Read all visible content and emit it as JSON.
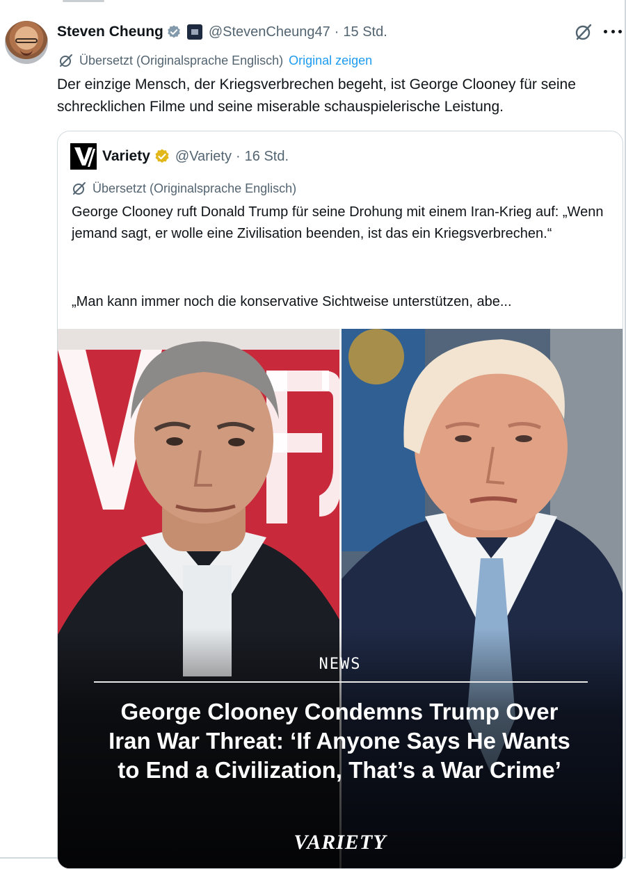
{
  "post": {
    "author_name": "Steven Cheung",
    "handle": "@StevenCheung47",
    "separator": "·",
    "time": "15 Std.",
    "translation_note": "Übersetzt (Originalsprache Englisch)",
    "show_original": "Original zeigen",
    "text": "Der einzige Mensch, der Kriegsverbrechen begeht, ist George Clooney für seine schrecklichen Filme und seine miserable schauspielerische Leistung.",
    "verified_color": "#829aab",
    "icons": [
      "translate-icon",
      "more-icon",
      "verified-badge-icon",
      "affiliation-flag-icon"
    ]
  },
  "quote": {
    "author_name": "Variety",
    "logo_letter": "V",
    "handle": "@Variety",
    "separator": "·",
    "time": "16 Std.",
    "translation_note": "Übersetzt (Originalsprache Englisch)",
    "text": "George Clooney ruft Donald Trump für seine Drohung mit einem Iran-Krieg auf: „Wenn jemand sagt, er wolle eine Zivilisation beenden, ist das ein Kriegsverbrechen.“",
    "text_continued": "„Man kann immer noch die konservative Sichtweise unterstützen, abe...",
    "verified_color": "#e2b719",
    "media": {
      "tag": "NEWS",
      "headline": "George Clooney Condemns Trump Over Iran War Threat: ‘If Anyone Says He Wants to End a Civilization, That’s a War Crime’",
      "brand": "VARIETY"
    }
  },
  "colors": {
    "text": "#0f1419",
    "secondary": "#536471",
    "link": "#1d9bf0",
    "border": "#cfd9de"
  }
}
